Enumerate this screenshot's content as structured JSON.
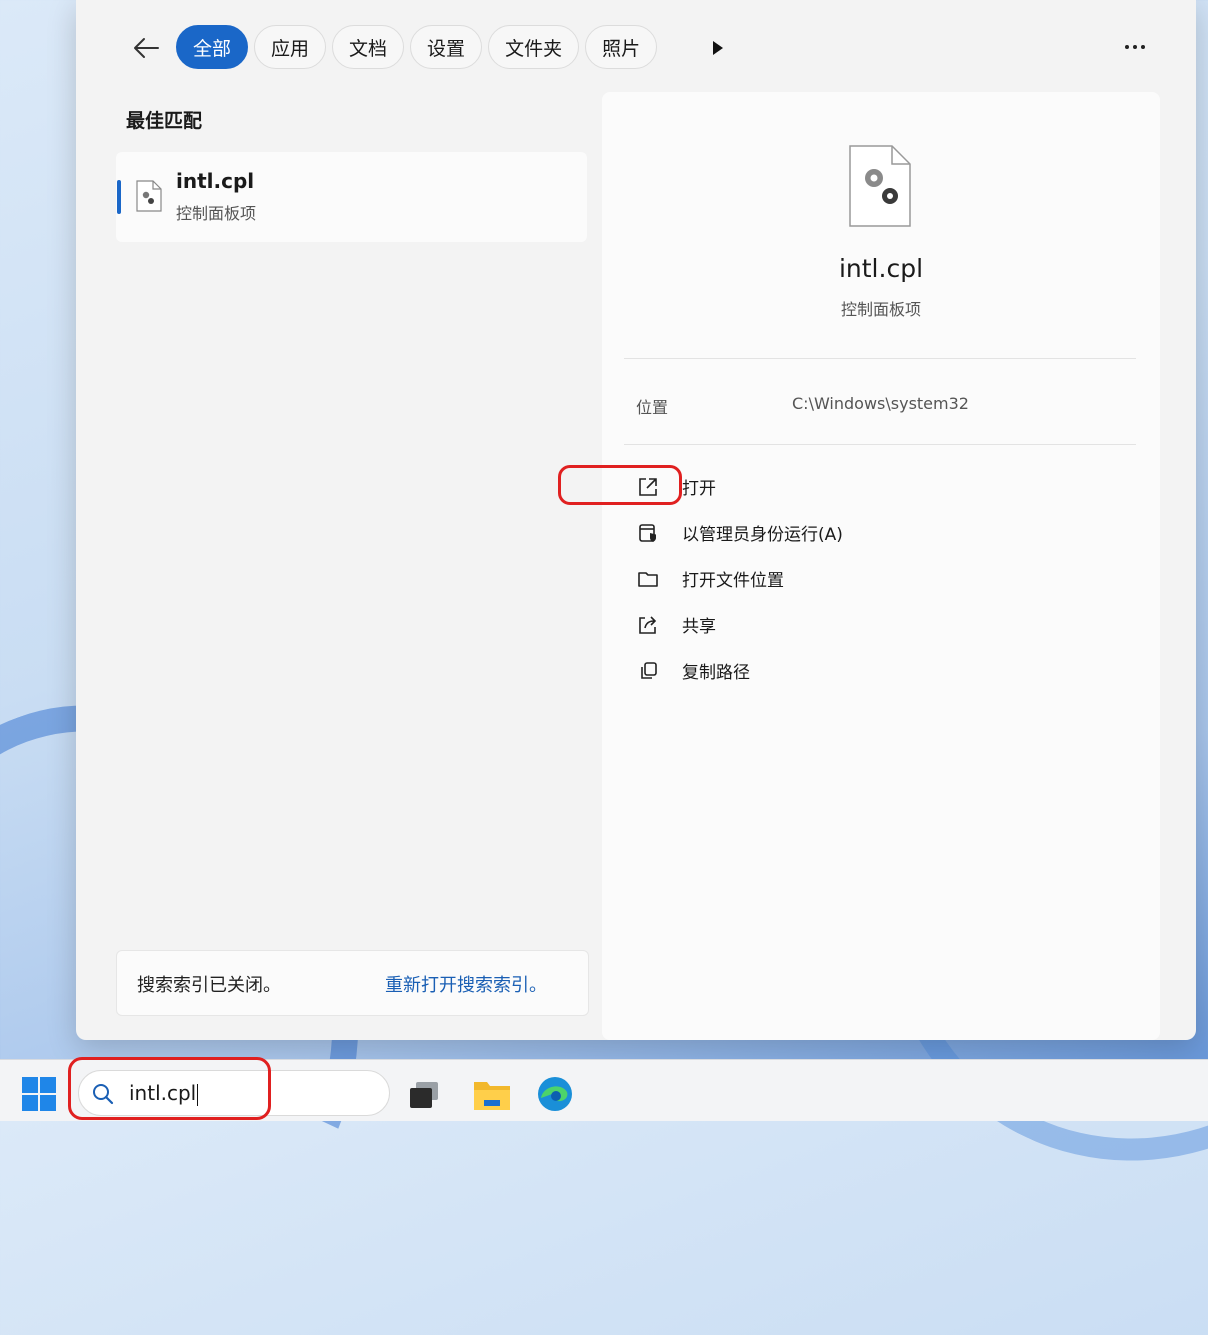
{
  "search_panel": {
    "tabs": [
      {
        "label": "全部",
        "active": true
      },
      {
        "label": "应用",
        "active": false
      },
      {
        "label": "文档",
        "active": false
      },
      {
        "label": "设置",
        "active": false
      },
      {
        "label": "文件夹",
        "active": false
      },
      {
        "label": "照片",
        "active": false
      }
    ],
    "best_match_title": "最佳匹配",
    "best_match": {
      "name": "intl.cpl",
      "type": "控制面板项"
    },
    "index_notice": {
      "message": "搜索索引已关闭。",
      "link": "重新打开搜索索引。"
    }
  },
  "detail": {
    "name": "intl.cpl",
    "type": "控制面板项",
    "location_label": "位置",
    "location_value": "C:\\Windows\\system32",
    "actions": [
      {
        "label": "打开",
        "icon": "open-external-icon"
      },
      {
        "label": "以管理员身份运行(A)",
        "icon": "run-as-admin-icon"
      },
      {
        "label": "打开文件位置",
        "icon": "folder-icon"
      },
      {
        "label": "共享",
        "icon": "share-icon"
      },
      {
        "label": "复制路径",
        "icon": "copy-icon"
      }
    ]
  },
  "taskbar": {
    "search_value": "intl.cpl",
    "apps": [
      "start-icon",
      "task-view-icon",
      "file-explorer-icon",
      "edge-icon"
    ]
  },
  "colors": {
    "accent": "#1a67c8",
    "highlight": "#e02020"
  }
}
